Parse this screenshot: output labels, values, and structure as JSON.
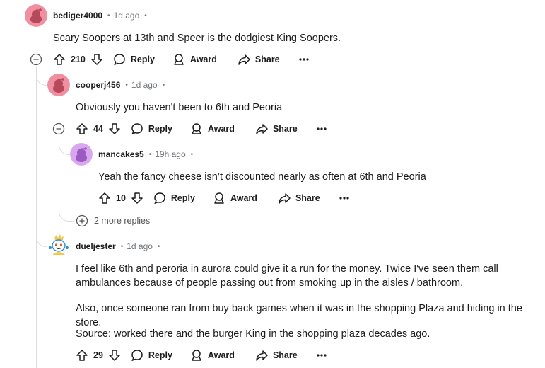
{
  "comments": [
    {
      "author": "bediger4000",
      "time": "1d ago",
      "text": "Scary Soopers at 13th and Speer is the dodgiest King Soopers.",
      "score": "210",
      "reply": "Reply",
      "award": "Award",
      "share": "Share",
      "avatar_color": "#f08fa0"
    },
    {
      "author": "cooperj456",
      "time": "1d ago",
      "text": "Obviously you haven't been to 6th and Peoria",
      "score": "44",
      "reply": "Reply",
      "award": "Award",
      "share": "Share",
      "avatar_color": "#f08fa0"
    },
    {
      "author": "mancakes5",
      "time": "19h ago",
      "text": "Yeah the fancy cheese isn’t discounted nearly as often at 6th and Peoria",
      "score": "10",
      "reply": "Reply",
      "award": "Award",
      "share": "Share",
      "avatar_color": "#d9a6f0"
    },
    {
      "author": "dueljester",
      "time": "1d ago",
      "paragraphs": [
        "I feel like 6th and peroria in aurora could give it a run for the money. Twice I've seen them call ambulances because of people passing out from smoking up in the aisles / bathroom.",
        "Also, once someone ran from buy back games when it was in the shopping Plaza and hiding in the store.",
        "Source: worked there and the burger King in the shopping plaza decades ago."
      ],
      "score": "29",
      "reply": "Reply",
      "award": "Award",
      "share": "Share"
    }
  ],
  "more_replies": "2 more replies",
  "separator": "•"
}
